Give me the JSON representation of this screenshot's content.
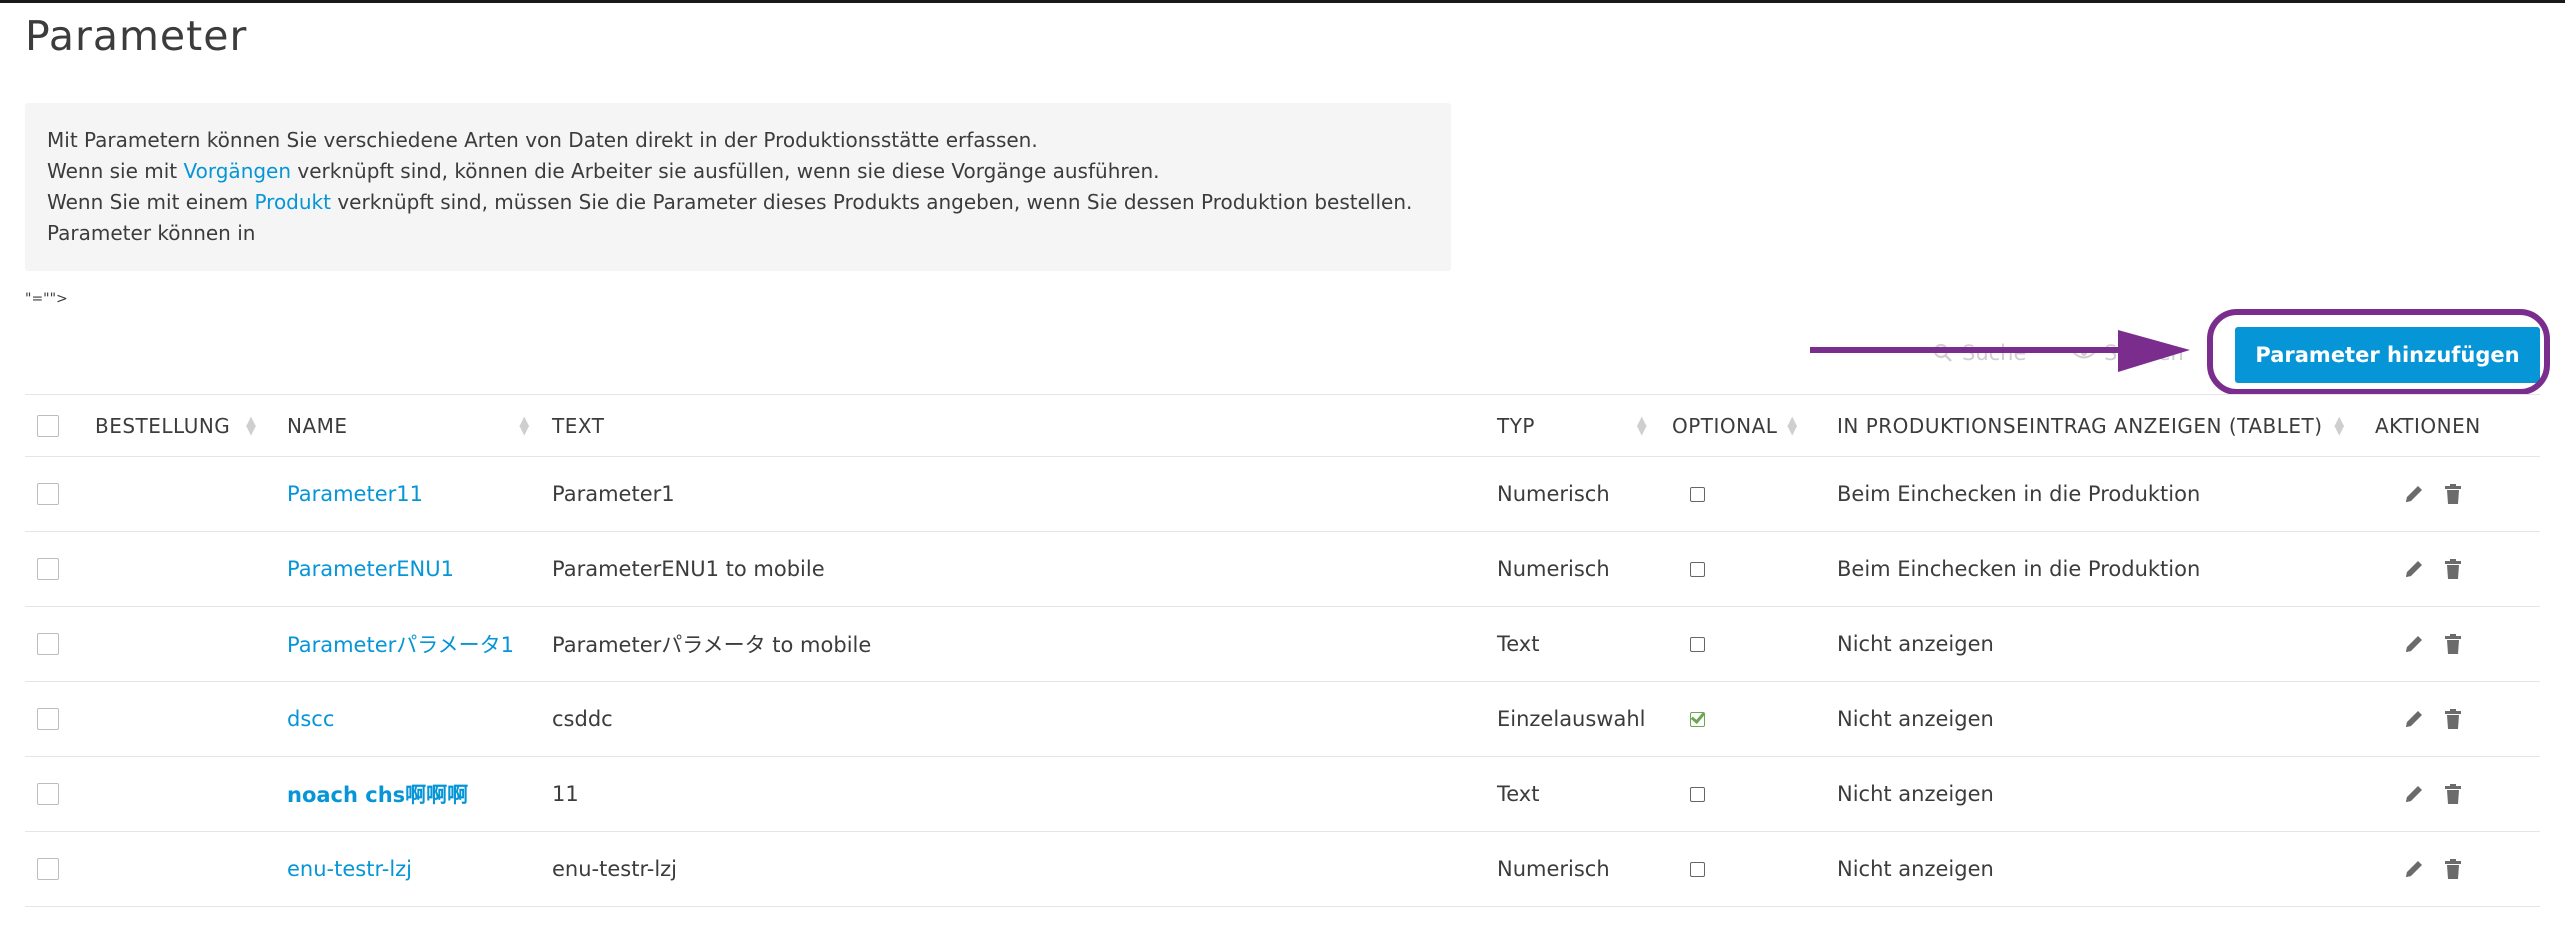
{
  "page_title": "Parameter",
  "info": {
    "line1": "Mit Parametern können Sie verschiedene Arten von Daten direkt in der Produktionsstätte erfassen.",
    "line2_pre": "Wenn sie mit ",
    "line2_link": "Vorgängen",
    "line2_post": " verknüpft sind, können die Arbeiter sie ausfüllen, wenn sie diese Vorgänge ausführen.",
    "line3_pre": "Wenn Sie mit einem ",
    "line3_link": "Produkt",
    "line3_post": " verknüpft sind, müssen Sie die Parameter dieses Produkts angeben, wenn Sie dessen Produktion bestellen.",
    "line4": "Parameter können in"
  },
  "stray_text": "\"=\"\">",
  "toolbar": {
    "search_label": "Suche",
    "columns_label": "Spalten",
    "add_button_label": "Parameter hinzufügen"
  },
  "colors": {
    "accent": "#0696d7",
    "highlight": "#7b2d8e",
    "check_green": "#6aa84f"
  },
  "table": {
    "headers": {
      "order": "BESTELLUNG",
      "name": "NAME",
      "text": "TEXT",
      "typ": "TYP",
      "optional": "OPTIONAL",
      "show": "IN PRODUKTIONSEINTRAG ANZEIGEN (TABLET)",
      "actions": "AKTIONEN"
    },
    "rows": [
      {
        "name": "Parameter11",
        "text": "Parameter1",
        "typ": "Numerisch",
        "optional": false,
        "show": "Beim Einchecken in die Produktion"
      },
      {
        "name": "ParameterENU1",
        "text": "ParameterENU1 to mobile",
        "typ": "Numerisch",
        "optional": false,
        "show": "Beim Einchecken in die Produktion"
      },
      {
        "name": "Parameterパラメータ1",
        "text": "Parameterパラメータ to mobile",
        "typ": "Text",
        "optional": false,
        "show": "Nicht anzeigen"
      },
      {
        "name": "dscc",
        "text": "csddc",
        "typ": "Einzelauswahl",
        "optional": true,
        "show": "Nicht anzeigen"
      },
      {
        "name": "noach chs啊啊啊",
        "text": "11",
        "typ": "Text",
        "optional": false,
        "show": "Nicht anzeigen"
      },
      {
        "name": "enu-testr-lzj",
        "text": "enu-testr-lzj",
        "typ": "Numerisch",
        "optional": false,
        "show": "Nicht anzeigen"
      }
    ]
  }
}
